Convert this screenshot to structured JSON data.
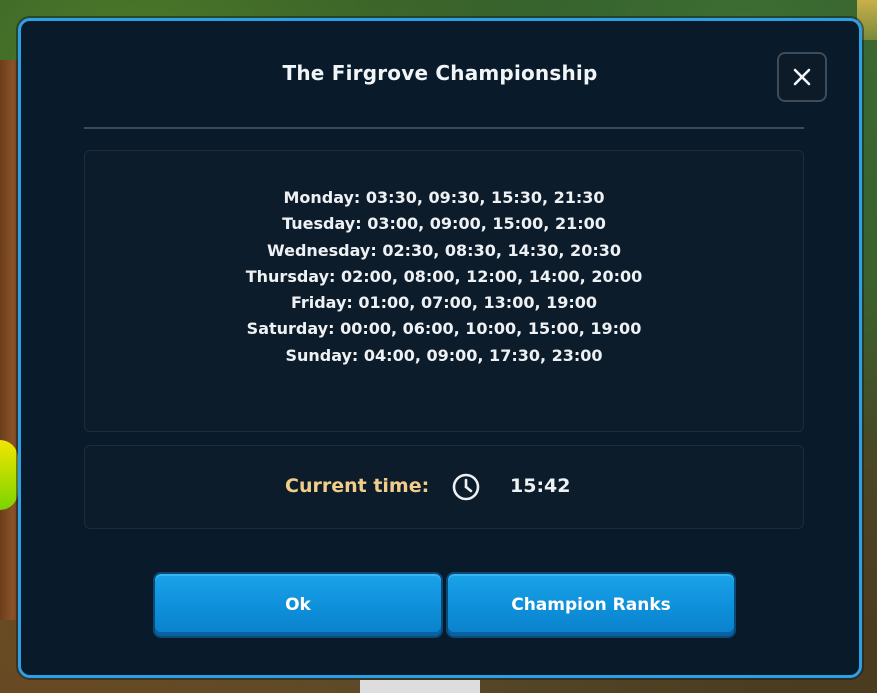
{
  "dialog": {
    "title": "The Firgrove Championship",
    "close_icon": "close-icon"
  },
  "schedule": [
    "Monday: 03:30, 09:30, 15:30, 21:30",
    "Tuesday: 03:00, 09:00, 15:00, 21:00",
    "Wednesday: 02:30, 08:30, 14:30, 20:30",
    "Thursday: 02:00, 08:00, 12:00, 14:00, 20:00",
    "Friday: 01:00, 07:00, 13:00, 19:00",
    "Saturday: 00:00, 06:00, 10:00, 15:00, 19:00",
    "Sunday: 04:00, 09:00, 17:30, 23:00"
  ],
  "current_time": {
    "label": "Current time:",
    "icon": "clock-icon",
    "value": "15:42"
  },
  "buttons": {
    "ok_label": "Ok",
    "ranks_label": "Champion Ranks"
  },
  "colors": {
    "border_accent": "#2e9fe0",
    "dialog_bg": "#091a2a",
    "time_label": "#f1cd8a",
    "button_blue": "#1aa4ea"
  }
}
